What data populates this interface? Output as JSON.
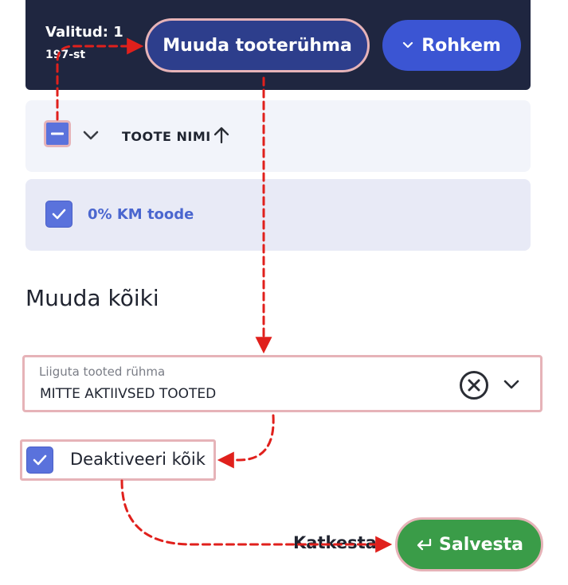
{
  "toolbar": {
    "selected_label": "Valitud: 1",
    "selected_count": "197-st",
    "change_group_button": "Muuda tooterühma",
    "more_button": "Rohkem"
  },
  "table": {
    "column_header": "TOOTE NIMI",
    "rows": [
      {
        "name": "0% KM toode",
        "checked": true
      }
    ]
  },
  "edit_all": {
    "title": "Muuda kõiki",
    "group_select": {
      "label": "Liiguta tooted rühma",
      "value": "MITTE AKTIIVSED TOOTED"
    },
    "deactivate_all": {
      "label": "Deaktiveeri kõik",
      "checked": true
    },
    "cancel_button": "Katkesta",
    "save_button": "Salvesta"
  },
  "colors": {
    "toolbar_bg": "#1f2640",
    "primary": "#3b55d3",
    "save_green": "#3a9c48",
    "annotation_arrow": "#e0201c",
    "highlight_outline": "#e6b3b8"
  },
  "icons": [
    "minus-icon",
    "chevron-down-icon",
    "sort-arrow-up-icon",
    "check-icon",
    "clear-circle-icon",
    "return-arrow-icon"
  ]
}
